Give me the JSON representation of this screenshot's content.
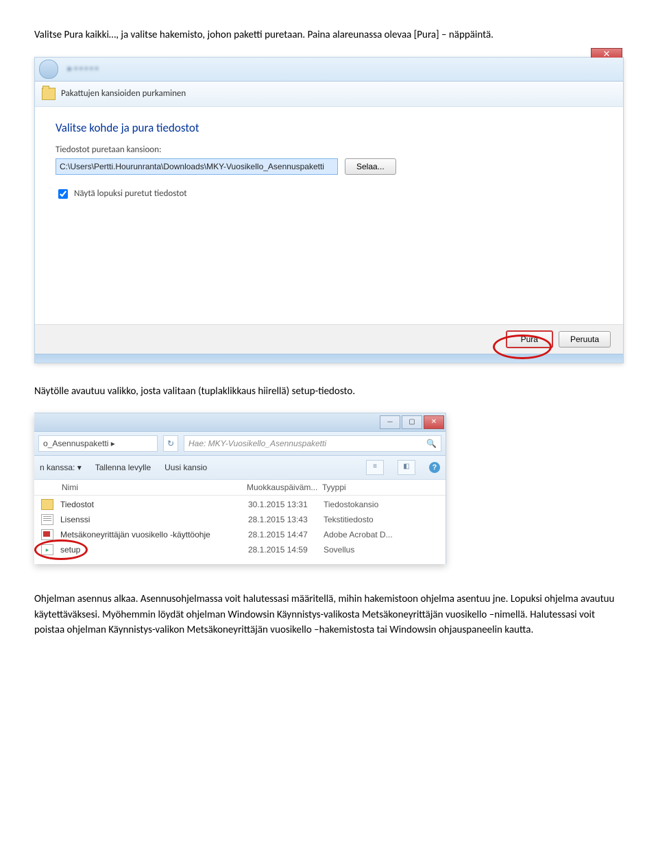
{
  "para1": "Valitse Pura kaikki…, ja valitse hakemisto, johon paketti puretaan. Paina alareunassa olevaa [Pura] – näppäintä.",
  "para2": "Näytölle avautuu valikko, josta valitaan (tuplaklikkaus hiirellä) setup-tiedosto.",
  "para3": "Ohjelman asennus alkaa. Asennusohjelmassa voit halutessasi määritellä, mihin hakemistoon ohjelma asentuu jne. Lopuksi ohjelma avautuu käytettäväksesi. Myöhemmin löydät ohjelman Windowsin Käynnistys-valikosta Metsäkoneyrittäjän vuosikello –nimellä. Halutessasi voit poistaa ohjelman Käynnistys-valikon Metsäkoneyrittäjän vuosikello –hakemistosta tai Windowsin ohjauspaneelin kautta.",
  "dialog1": {
    "window_title": "Pakattujen kansioiden purkaminen",
    "heading": "Valitse kohde ja pura tiedostot",
    "dest_label": "Tiedostot puretaan kansioon:",
    "dest_value": "C:\\Users\\Pertti.Hourunranta\\Downloads\\MKY-Vuosikello_Asennuspaketti",
    "browse": "Selaa...",
    "show_checkbox": "Näytä lopuksi puretut tiedostot",
    "primary": "Pura",
    "cancel": "Peruuta",
    "close_x": "✕"
  },
  "explorer": {
    "crumb": "o_Asennuspaketti ▸",
    "refresh": "↻",
    "search_placeholder": "Hae: MKY-Vuosikello_Asennuspaketti",
    "toolbar": {
      "open_with": "n kanssa: ▾",
      "save_disk": "Tallenna levylle",
      "new_folder": "Uusi kansio"
    },
    "columns": {
      "name": "Nimi",
      "date": "Muokkauspäiväm...",
      "type": "Tyyppi"
    },
    "rows": [
      {
        "name": "Tiedostot",
        "date": "30.1.2015 13:31",
        "type": "Tiedostokansio",
        "ic": "folder"
      },
      {
        "name": "Lisenssi",
        "date": "28.1.2015 13:43",
        "type": "Tekstitiedosto",
        "ic": "text"
      },
      {
        "name": "Metsäkoneyrittäjän vuosikello -käyttöohje",
        "date": "28.1.2015 14:47",
        "type": "Adobe Acrobat D...",
        "ic": "pdf"
      },
      {
        "name": "setup",
        "date": "28.1.2015 14:59",
        "type": "Sovellus",
        "ic": "setup"
      }
    ],
    "win_min": "—",
    "win_max": "▢",
    "win_close": "✕",
    "help": "?"
  }
}
